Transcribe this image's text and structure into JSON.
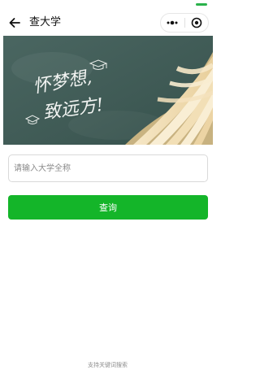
{
  "nav": {
    "title": "查大学",
    "back_icon": "back-arrow-icon",
    "more_icon": "more-dots-icon",
    "close_icon": "target-close-icon"
  },
  "banner": {
    "slogan_line1": "怀梦想,",
    "slogan_line2": "致远方!"
  },
  "search": {
    "placeholder": "请输入大学全称",
    "value": "",
    "button_label": "查询"
  },
  "footer": {
    "hint": "支持关键词搜索"
  },
  "colors": {
    "accent": "#14b529",
    "status": "#2ab24b",
    "chalkboard": "#3f5a55"
  }
}
